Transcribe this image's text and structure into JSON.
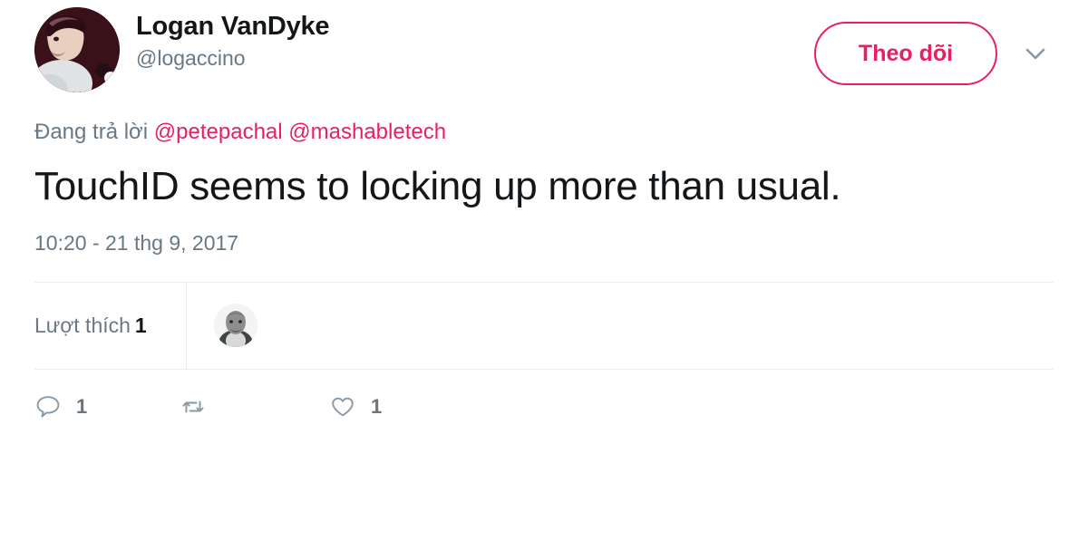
{
  "author": {
    "display_name": "Logan VanDyke",
    "handle": "@logaccino",
    "avatar_icon": "user-avatar-photo"
  },
  "header": {
    "follow_label": "Theo dõi",
    "caret_icon": "chevron-down-icon"
  },
  "reply_context": {
    "prefix": "Đang trả lời",
    "mentions": "@petepachal @mashabletech"
  },
  "tweet": {
    "text": "TouchID seems to locking up more than usual.",
    "timestamp": "10:20 - 21 thg 9, 2017"
  },
  "likes": {
    "label": "Lượt thích",
    "count": "1",
    "liker_avatar_icon": "liker-avatar-photo"
  },
  "actions": {
    "reply": {
      "icon": "reply-icon",
      "count": "1"
    },
    "retweet": {
      "icon": "retweet-icon",
      "count": ""
    },
    "like": {
      "icon": "heart-icon",
      "count": "1"
    }
  },
  "colors": {
    "accent": "#e8205f",
    "text_primary": "#14171a",
    "text_secondary": "#697882",
    "divider": "#e6ecf0",
    "background": "#ffffff"
  }
}
